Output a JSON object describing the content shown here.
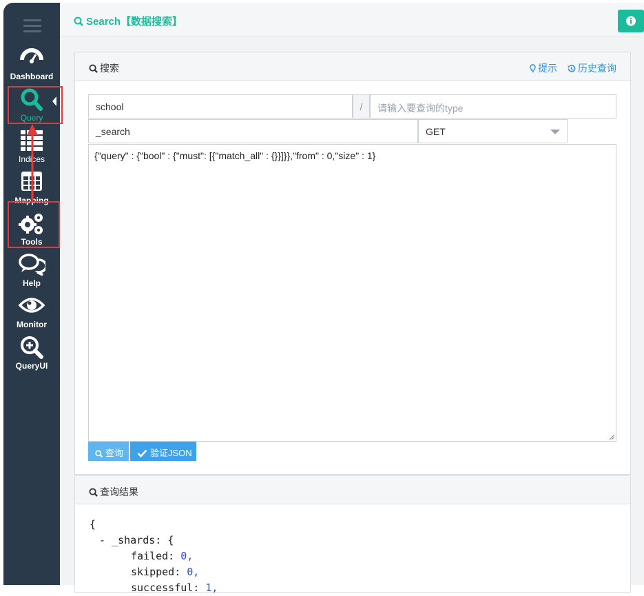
{
  "sidebar": {
    "items": [
      {
        "label": "Dashboard",
        "icon": "dashboard-icon"
      },
      {
        "label": "Query",
        "icon": "search-icon"
      },
      {
        "label": "Indices",
        "icon": "list-icon"
      },
      {
        "label": "Mapping",
        "icon": "table-icon"
      },
      {
        "label": "Tools",
        "icon": "gears-icon"
      },
      {
        "label": "Help",
        "icon": "comments-icon"
      },
      {
        "label": "Monitor",
        "icon": "eye-icon"
      },
      {
        "label": "QueryUI",
        "icon": "zoom-in-icon"
      }
    ],
    "active": "Query"
  },
  "header": {
    "title": "Search【数据搜索】",
    "info_icon": "info-icon"
  },
  "search_panel": {
    "title": "搜索",
    "hint_label": "提示",
    "history_label": "历史查询",
    "index_value": "school",
    "separator": "/",
    "type_placeholder": "请输入要查询的type",
    "endpoint_value": "_search",
    "method_value": "GET",
    "body_value": "{\"query\" : {\"bool\" : {\"must\": [{\"match_all\" : {}}]}},\"from\" : 0,\"size\" : 1}",
    "query_button": "查询",
    "validate_button": "验证JSON"
  },
  "result_panel": {
    "title": "查询结果",
    "lines": {
      "open": "{",
      "shards_key": "- _shards: {",
      "failed_key": "failed:",
      "failed_val": "0,",
      "skipped_key": "skipped:",
      "skipped_val": "0,",
      "next_key": "successful:",
      "next_val": "1,"
    }
  },
  "colors": {
    "sidebar_bg": "#2b3a4a",
    "accent": "#1abc9c",
    "link": "#3a8fd8",
    "highlight": "#e53935"
  }
}
